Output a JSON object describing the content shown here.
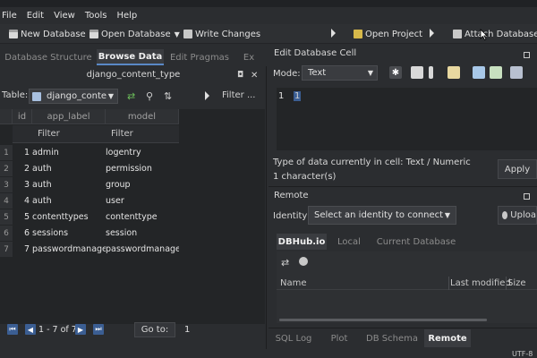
{
  "menu": [
    "File",
    "Edit",
    "View",
    "Tools",
    "Help"
  ],
  "toolbar": {
    "new_database": "New Database",
    "open_database": "Open Database",
    "write_changes": "Write Changes",
    "open_project": "Open Project",
    "attach_database": "Attach Database"
  },
  "tabs": [
    "Database Structure",
    "Browse Data",
    "Edit Pragmas",
    "Ex"
  ],
  "browse": {
    "title": "django_content_type",
    "table_label": "Table:",
    "table_value": "django_conte",
    "filter_placeholder": "Filter ...",
    "columns": [
      "id",
      "app_label",
      "model"
    ],
    "filter_label": "Filter",
    "rows": [
      {
        "n": "1",
        "id": "1",
        "app_label": "admin",
        "model": "logentry"
      },
      {
        "n": "2",
        "id": "2",
        "app_label": "auth",
        "model": "permission"
      },
      {
        "n": "3",
        "id": "3",
        "app_label": "auth",
        "model": "group"
      },
      {
        "n": "4",
        "id": "4",
        "app_label": "auth",
        "model": "user"
      },
      {
        "n": "5",
        "id": "5",
        "app_label": "contenttypes",
        "model": "contenttype"
      },
      {
        "n": "6",
        "id": "6",
        "app_label": "sessions",
        "model": "session"
      },
      {
        "n": "7",
        "id": "7",
        "app_label": "passwordmanager",
        "model": "passwordmanager"
      }
    ],
    "record_count": "1 - 7 of 7",
    "goto_label": "Go to:",
    "goto_value": "1"
  },
  "edit_cell": {
    "title": "Edit Database Cell",
    "mode_label": "Mode:",
    "mode_value": "Text",
    "line_number": "1",
    "cell_value": "1",
    "type_info": "Type of data currently in cell: Text / Numeric",
    "char_info": "1 character(s)",
    "apply": "Apply"
  },
  "remote": {
    "title": "Remote",
    "identity_label": "Identity",
    "identity_value": "Select an identity to connect",
    "upload": "Uploa",
    "tabs": [
      "DBHub.io",
      "Local",
      "Current Database"
    ],
    "columns": [
      "Name",
      "Last modified",
      "Size"
    ]
  },
  "bottom_tabs": [
    "SQL Log",
    "Plot",
    "DB Schema",
    "Remote"
  ],
  "status": "UTF-8",
  "colors": {
    "accent": "#5a88c6",
    "background": "#2b2d30",
    "grid": "#232527"
  }
}
